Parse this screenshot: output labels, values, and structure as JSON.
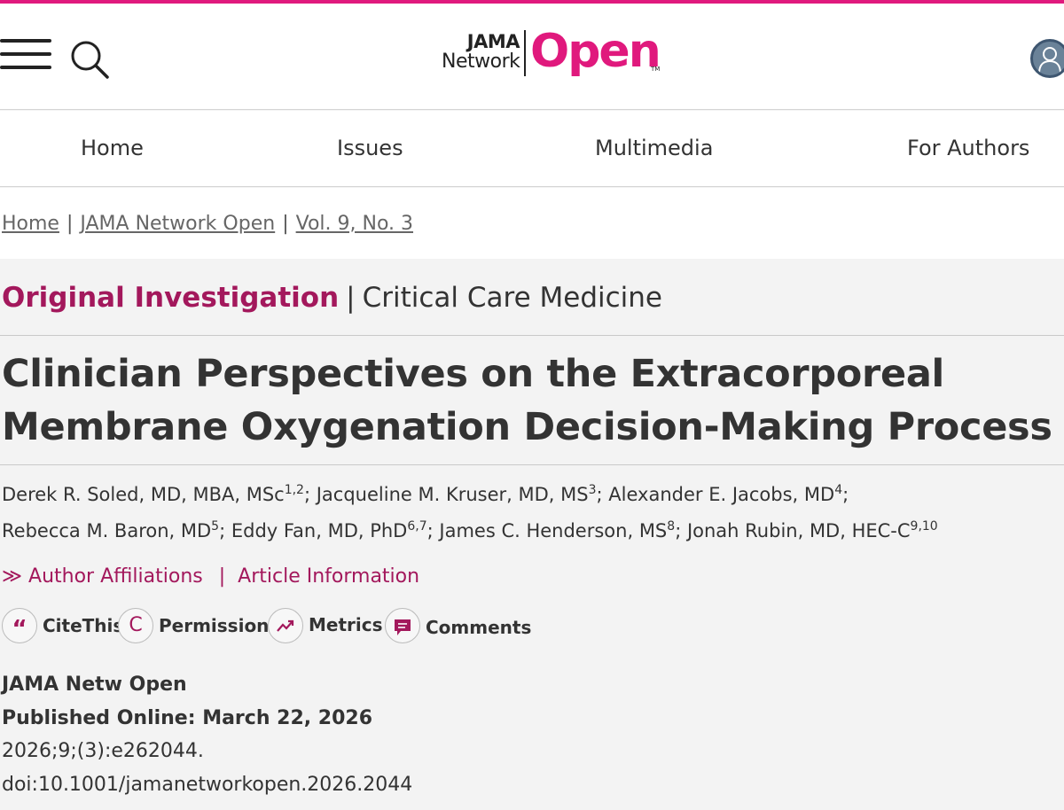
{
  "header": {
    "logo_jama": "JAMA",
    "logo_network": "Network",
    "logo_open": "Open",
    "logo_tm": "TM",
    "brand_color": "#e0197d",
    "icons": [
      "menu-icon",
      "search-icon",
      "user-avatar-icon"
    ]
  },
  "nav": {
    "items": [
      {
        "label": "Home"
      },
      {
        "label": "Issues"
      },
      {
        "label": "Multimedia"
      },
      {
        "label": "For Authors"
      }
    ]
  },
  "breadcrumb": {
    "items": [
      {
        "label": "Home"
      },
      {
        "label": "JAMA Network Open"
      },
      {
        "label": "Vol. 9, No. 3"
      }
    ],
    "separator": "|"
  },
  "article": {
    "category_main": "Original Investigation",
    "category_sep": "|",
    "category_sub": "Critical Care Medicine",
    "accent_color": "#a3185c",
    "title": "Clinician Perspectives on the Extracorporeal Membrane Oxygenation Decision-Making Process",
    "authors": [
      {
        "name": "Derek R. Soled, MD, MBA, MSc",
        "sup": "1,2"
      },
      {
        "name": "Jacqueline M. Kruser, MD, MS",
        "sup": "3"
      },
      {
        "name": "Alexander E. Jacobs, MD",
        "sup": "4"
      },
      {
        "name": "Rebecca M. Baron, MD",
        "sup": "5"
      },
      {
        "name": "Eddy Fan, MD, PhD",
        "sup": "6,7"
      },
      {
        "name": "James C. Henderson, MS",
        "sup": "8"
      },
      {
        "name": "Jonah Rubin, MD, HEC-C",
        "sup": "9,10"
      }
    ],
    "author_sep": ";",
    "links": {
      "affiliations_glyph": "≫",
      "affiliations": "Author Affiliations",
      "sep": "|",
      "article_info": "Article Information"
    },
    "tools": [
      {
        "label": "CiteThis",
        "glyph": "“",
        "icon": "quote-icon"
      },
      {
        "label": "Permissions",
        "glyph": "C",
        "icon": "copyright-icon"
      },
      {
        "label": "Metrics",
        "icon": "trend-icon"
      },
      {
        "label": "Comments",
        "icon": "comment-icon"
      }
    ],
    "meta": {
      "journal": "JAMA Netw Open",
      "published": "Published Online: March 22, 2026",
      "citation": "2026;9;(3):e262044.",
      "doi": "doi:10.1001/jamanetworkopen.2026.2044"
    }
  }
}
